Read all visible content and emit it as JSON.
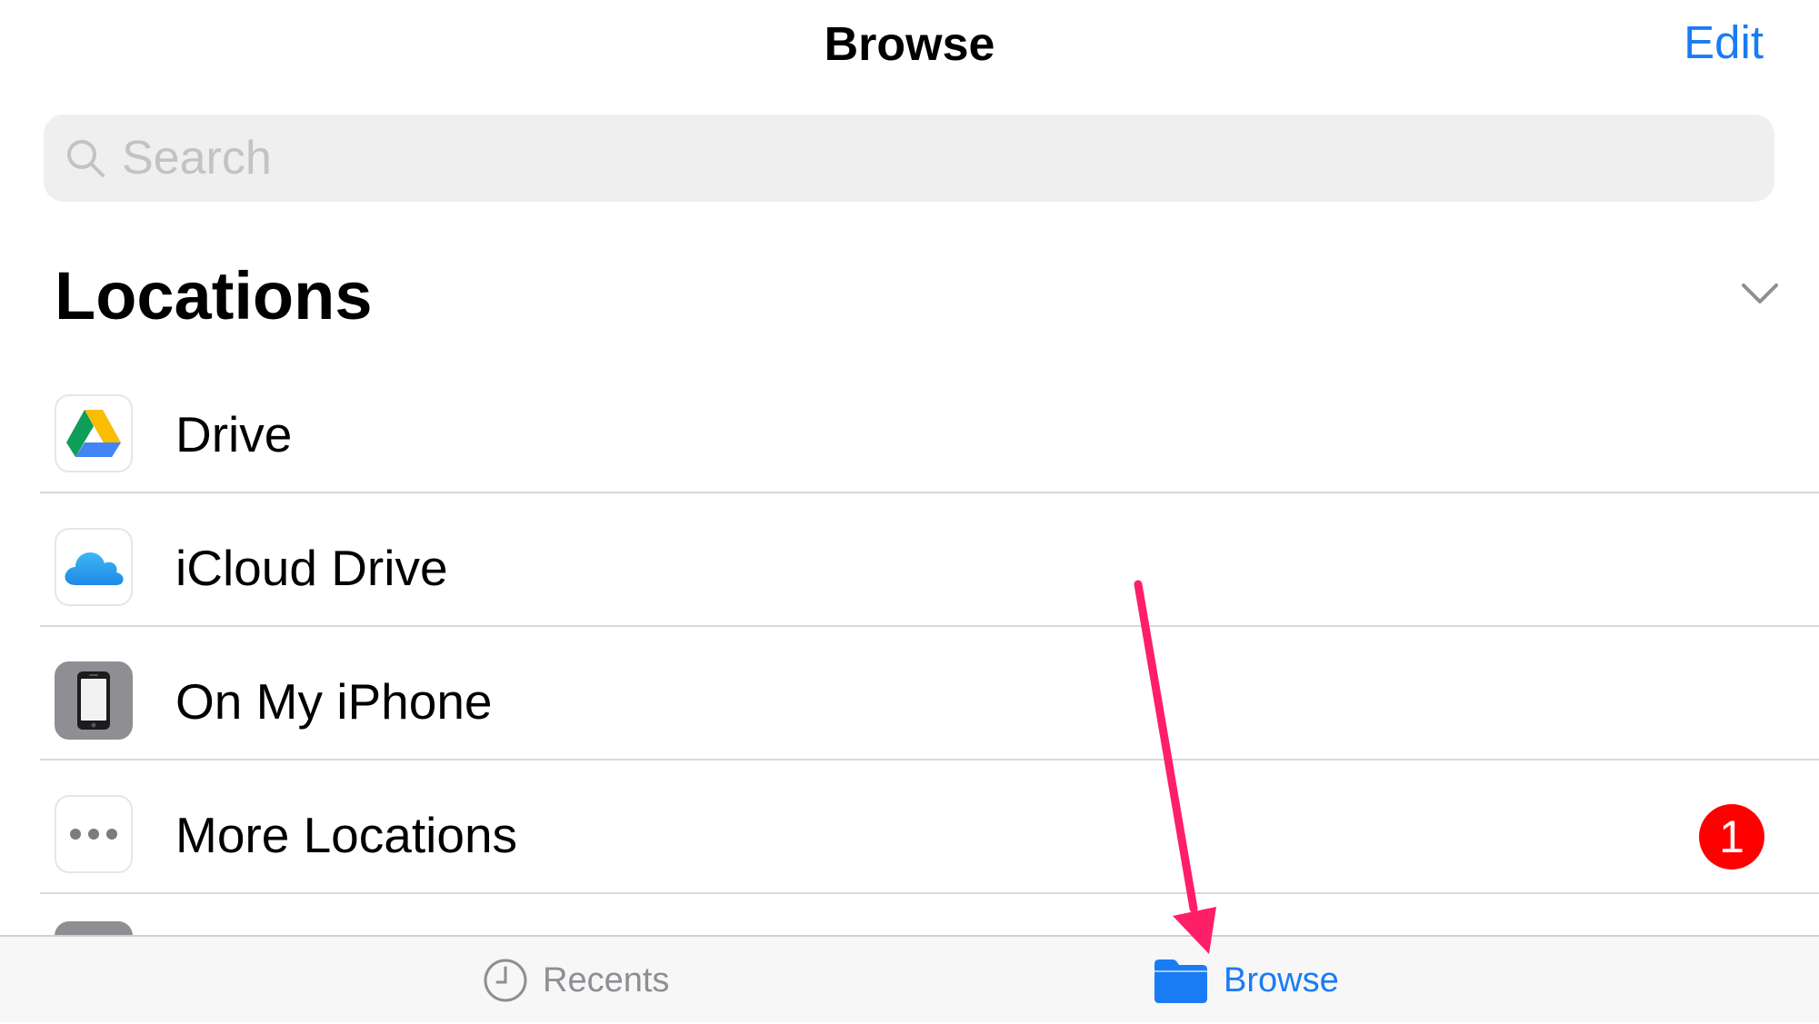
{
  "nav": {
    "title": "Browse",
    "edit_label": "Edit"
  },
  "search": {
    "placeholder": "Search"
  },
  "section": {
    "title": "Locations"
  },
  "locations": [
    {
      "label": "Drive",
      "icon": "google-drive-icon"
    },
    {
      "label": "iCloud Drive",
      "icon": "icloud-icon"
    },
    {
      "label": "On My iPhone",
      "icon": "iphone-icon"
    },
    {
      "label": "More Locations",
      "icon": "more-dots-icon",
      "badge": "1"
    }
  ],
  "tabs": [
    {
      "label": "Recents",
      "icon": "clock-icon",
      "selected": false
    },
    {
      "label": "Browse",
      "icon": "folder-icon",
      "selected": true
    }
  ],
  "colors": {
    "accent": "#1a7cf5",
    "badge": "#ff0000",
    "annotation_arrow": "#ff1f68",
    "search_bg": "#efeff0",
    "placeholder": "#c3c3c7",
    "separator": "#d8d8da",
    "tab_bar_bg": "#f7f7f7",
    "tab_inactive": "#8e8e93"
  }
}
